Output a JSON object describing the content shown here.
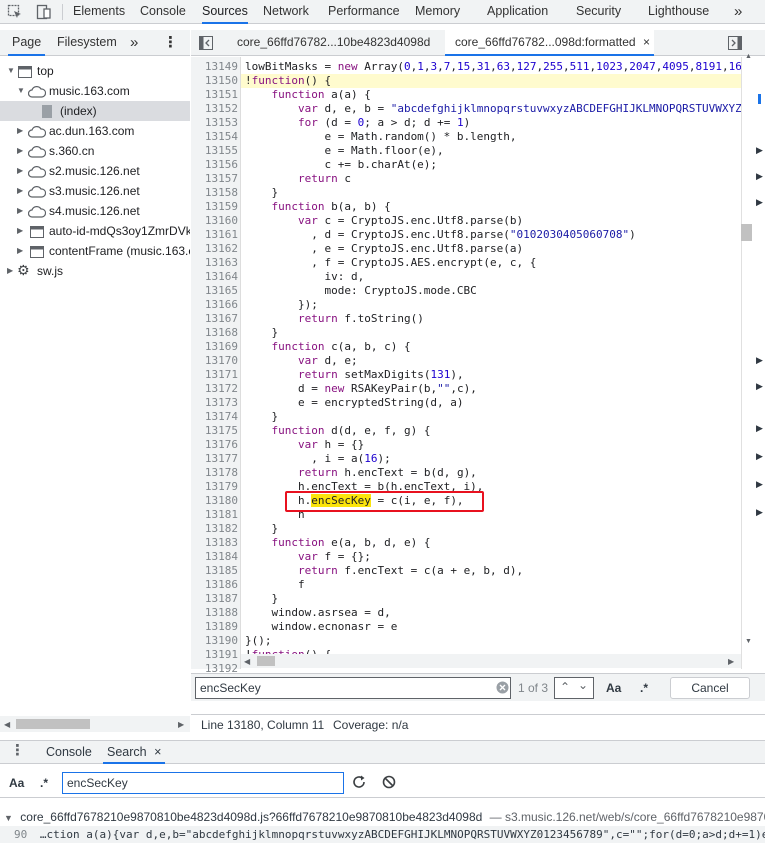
{
  "topbar": {
    "tabs": [
      "Elements",
      "Console",
      "Sources",
      "Network",
      "Performance",
      "Memory",
      "Application",
      "Security",
      "Lighthouse"
    ],
    "active_tab": "Sources",
    "more": "»"
  },
  "navigator": {
    "tabs": [
      "Page",
      "Filesystem"
    ],
    "more": "»",
    "menu": "⋮",
    "tree": [
      {
        "label": "top",
        "depth": 0,
        "expanded": true,
        "icon": "frame-icon"
      },
      {
        "label": "music.163.com",
        "depth": 1,
        "expanded": true,
        "icon": "cloud-icon"
      },
      {
        "label": "(index)",
        "depth": 2,
        "icon": "file-icon",
        "selected": true
      },
      {
        "label": "ac.dun.163.com",
        "depth": 1,
        "expanded": false,
        "icon": "cloud-icon"
      },
      {
        "label": "s.360.cn",
        "depth": 1,
        "expanded": false,
        "icon": "cloud-icon"
      },
      {
        "label": "s2.music.126.net",
        "depth": 1,
        "expanded": false,
        "icon": "cloud-icon"
      },
      {
        "label": "s3.music.126.net",
        "depth": 1,
        "expanded": false,
        "icon": "cloud-icon"
      },
      {
        "label": "s4.music.126.net",
        "depth": 1,
        "expanded": false,
        "icon": "cloud-icon"
      },
      {
        "label": "auto-id-mdQs3oy1ZmrDVk",
        "depth": 1,
        "expanded": false,
        "icon": "frame-icon"
      },
      {
        "label": "contentFrame (music.163.c",
        "depth": 1,
        "expanded": false,
        "icon": "frame-icon"
      },
      {
        "label": "sw.js",
        "depth": 0,
        "expanded": false,
        "icon": "gear-icon"
      }
    ]
  },
  "editor": {
    "tabs": [
      {
        "label": "core_66ffd76782...10be4823d4098d",
        "closable": false
      },
      {
        "label": "core_66ffd76782...098d:formatted",
        "closable": true
      }
    ],
    "close": "×",
    "lines": [
      {
        "n": "13149",
        "html": "lowBitMasks = <span class='kw'>new</span> Array(<span class='num'>0</span>,<span class='num'>1</span>,<span class='num'>3</span>,<span class='num'>7</span>,<span class='num'>15</span>,<span class='num'>31</span>,<span class='num'>63</span>,<span class='num'>127</span>,<span class='num'>255</span>,<span class='num'>511</span>,<span class='num'>1023</span>,<span class='num'>2047</span>,<span class='num'>4095</span>,<span class='num'>8191</span>,<span class='num'>16</span>"
      },
      {
        "n": "13150",
        "html": "!<span class='kw'>function</span>() {",
        "current": true
      },
      {
        "n": "13151",
        "html": "    <span class='kw'>function</span> a(a) {"
      },
      {
        "n": "13152",
        "html": "        <span class='kw'>var</span> d, e, b = <span class='str'>\"abcdefghijklmnopqrstuvwxyzABCDEFGHIJKLMNOPQRSTUVWXYZ</span>"
      },
      {
        "n": "13153",
        "html": "        <span class='kw'>for</span> (d = <span class='num'>0</span>; a &gt; d; d += <span class='num'>1</span>)"
      },
      {
        "n": "13154",
        "html": "            e = Math.random() * b.length,"
      },
      {
        "n": "13155",
        "html": "            e = Math.floor(e),"
      },
      {
        "n": "13156",
        "html": "            c += b.charAt(e);"
      },
      {
        "n": "13157",
        "html": "        <span class='kw'>return</span> c"
      },
      {
        "n": "13158",
        "html": "    }"
      },
      {
        "n": "13159",
        "html": "    <span class='kw'>function</span> b(a, b) {"
      },
      {
        "n": "13160",
        "html": "        <span class='kw'>var</span> c = CryptoJS.enc.Utf8.parse(b)"
      },
      {
        "n": "13161",
        "html": "          , d = CryptoJS.enc.Utf8.parse(<span class='str'>\"0102030405060708\"</span>)"
      },
      {
        "n": "13162",
        "html": "          , e = CryptoJS.enc.Utf8.parse(a)"
      },
      {
        "n": "13163",
        "html": "          , f = CryptoJS.AES.encrypt(e, c, {"
      },
      {
        "n": "13164",
        "html": "            iv: d,"
      },
      {
        "n": "13165",
        "html": "            mode: CryptoJS.mode.CBC"
      },
      {
        "n": "13166",
        "html": "        });"
      },
      {
        "n": "13167",
        "html": "        <span class='kw'>return</span> f.toString()"
      },
      {
        "n": "13168",
        "html": "    }"
      },
      {
        "n": "13169",
        "html": "    <span class='kw'>function</span> c(a, b, c) {"
      },
      {
        "n": "13170",
        "html": "        <span class='kw'>var</span> d, e;"
      },
      {
        "n": "13171",
        "html": "        <span class='kw'>return</span> setMaxDigits(<span class='num'>131</span>),"
      },
      {
        "n": "13172",
        "html": "        d = <span class='kw'>new</span> RSAKeyPair(b,<span class='str'>\"\"</span>,c),"
      },
      {
        "n": "13173",
        "html": "        e = encryptedString(d, a)"
      },
      {
        "n": "13174",
        "html": "    }"
      },
      {
        "n": "13175",
        "html": "    <span class='kw'>function</span> d(d, e, f, g) {"
      },
      {
        "n": "13176",
        "html": "        <span class='kw'>var</span> h = {}"
      },
      {
        "n": "13177",
        "html": "          , i = a(<span class='num'>16</span>);"
      },
      {
        "n": "13178",
        "html": "        <span class='kw'>return</span> h.encText = b(d, g),"
      },
      {
        "n": "13179",
        "html": "        h.encText = b(h.encText, i),"
      },
      {
        "n": "13180",
        "html": "        h.<span class='hl'>encSecKey</span> = c(i, e, f),"
      },
      {
        "n": "13181",
        "html": "        h"
      },
      {
        "n": "13182",
        "html": "    }"
      },
      {
        "n": "13183",
        "html": "    <span class='kw'>function</span> e(a, b, d, e) {"
      },
      {
        "n": "13184",
        "html": "        <span class='kw'>var</span> f = {};"
      },
      {
        "n": "13185",
        "html": "        <span class='kw'>return</span> f.encText = c(a + e, b, d),"
      },
      {
        "n": "13186",
        "html": "        f"
      },
      {
        "n": "13187",
        "html": "    }"
      },
      {
        "n": "13188",
        "html": "    window.asrsea = d,"
      },
      {
        "n": "13189",
        "html": "    window.ecnonasr = e"
      },
      {
        "n": "13190",
        "html": "}();"
      },
      {
        "n": "13191",
        "html": "!<span class='kw'>function</span>() {"
      },
      {
        "n": "13192",
        "html": ""
      }
    ]
  },
  "findbar": {
    "query": "encSecKey",
    "match_count": "1 of 3",
    "case_label": "Aa",
    "regex_label": ".*",
    "cancel_label": "Cancel"
  },
  "statusbar": {
    "position": "Line 13180, Column 11",
    "coverage": "Coverage: n/a"
  },
  "drawer": {
    "tabs": [
      "Console",
      "Search"
    ],
    "active_tab": "Search",
    "close": "×",
    "menu": "⋮",
    "case_label": "Aa",
    "regex_label": ".*",
    "query": "encSecKey",
    "result_file": "core_66ffd7678210e9870810be4823d4098d.js?66ffd7678210e9870810be4823d4098d",
    "result_url": "— s3.music.126.net/web/s/core_66ffd7678210e9870810",
    "result_line_no": "90",
    "result_line_text": "…ction a(a){var d,e,b=\"abcdefghijklmnopqrstuvwxyzABCDEFGHIJKLMNOPQRSTUVWXYZ0123456789\",c=\"\";for(d=0;a>d;d+=1)e=Math.rando"
  }
}
